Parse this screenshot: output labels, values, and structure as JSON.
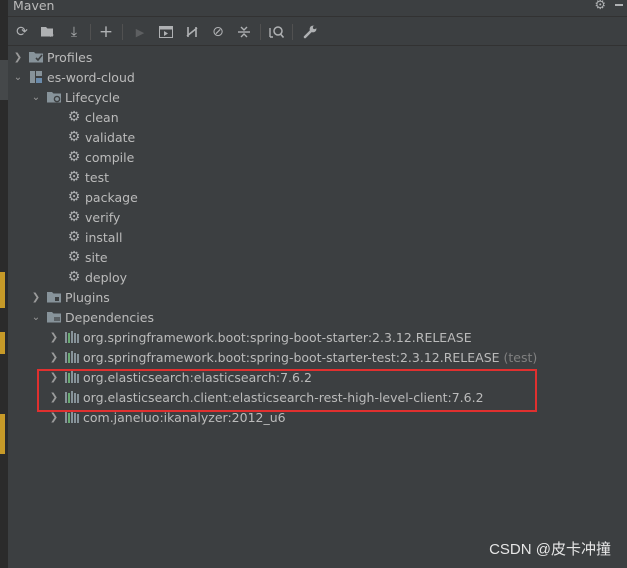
{
  "panel": {
    "title": "Maven"
  },
  "toolbar": [
    {
      "name": "reload-icon",
      "glyph": "⟳",
      "disabled": false
    },
    {
      "name": "add-maven-project-icon",
      "glyph": "",
      "disabled": false
    },
    {
      "name": "download-sources-icon",
      "glyph": "⤓",
      "disabled": false
    },
    {
      "name": "add-icon",
      "glyph": "+",
      "disabled": false
    },
    {
      "name": "run-icon",
      "glyph": "▶",
      "disabled": true
    },
    {
      "name": "execute-goal-icon",
      "glyph": "",
      "disabled": false
    },
    {
      "name": "toggle-offline-icon",
      "glyph": "⧸",
      "disabled": false
    },
    {
      "name": "skip-tests-icon",
      "glyph": "⊘",
      "disabled": false
    },
    {
      "name": "collapse-all-icon",
      "glyph": "≑",
      "disabled": false
    },
    {
      "name": "show-dependencies-icon",
      "glyph": "",
      "disabled": false
    },
    {
      "name": "settings-wrench-icon",
      "glyph": "🔧",
      "disabled": false
    }
  ],
  "tree": {
    "profiles": "Profiles",
    "project": "es-word-cloud",
    "lifecycle": "Lifecycle",
    "goals": [
      "clean",
      "validate",
      "compile",
      "test",
      "package",
      "verify",
      "install",
      "site",
      "deploy"
    ],
    "plugins": "Plugins",
    "dependencies": "Dependencies",
    "deps": [
      {
        "label": "org.springframework.boot:spring-boot-starter:2.3.12.RELEASE",
        "suffix": ""
      },
      {
        "label": "org.springframework.boot:spring-boot-starter-test:2.3.12.RELEASE",
        "suffix": "(test)"
      },
      {
        "label": "org.elasticsearch:elasticsearch:7.6.2",
        "suffix": ""
      },
      {
        "label": "org.elasticsearch.client:elasticsearch-rest-high-level-client:7.6.2",
        "suffix": ""
      },
      {
        "label": "com.janeluo:ikanalyzer:2012_u6",
        "suffix": ""
      }
    ]
  },
  "watermark": "CSDN @皮卡冲撞",
  "colors": {
    "folder": "#87939a",
    "dep_bar": "#6aab73",
    "highlight": "#e0302f"
  }
}
